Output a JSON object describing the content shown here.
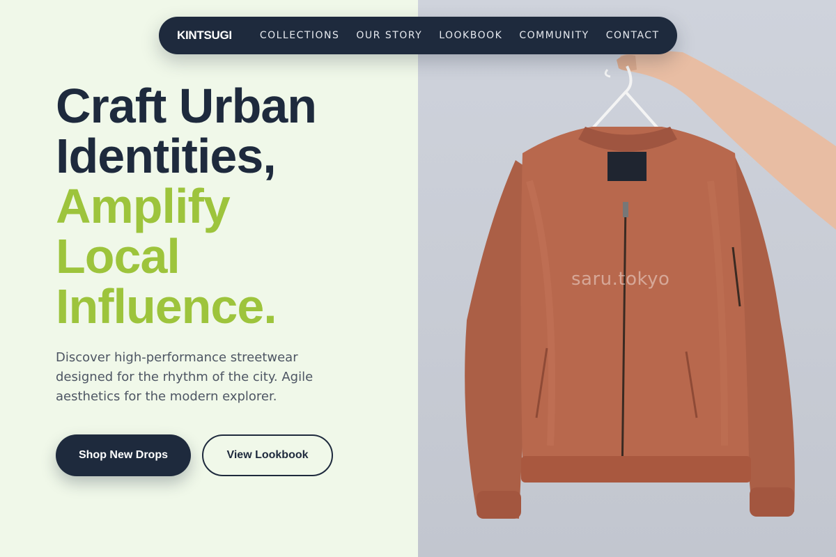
{
  "nav": {
    "brand": "KINTSUGI",
    "links": [
      "COLLECTIONS",
      "OUR STORY",
      "LOOKBOOK",
      "COMMUNITY",
      "CONTACT"
    ]
  },
  "hero": {
    "headline_dark": [
      "Craft Urban",
      "Identities,"
    ],
    "headline_accent": [
      "Amplify",
      "Local",
      "Influence."
    ],
    "description": "Discover high-performance streetwear designed for the rhythm of the city. Agile aesthetics for the modern explorer.",
    "primary_cta": "Shop New Drops",
    "secondary_cta": "View Lookbook"
  },
  "image": {
    "subject": "rust-colored bomber jacket on a hanger held by a hand",
    "watermark": "saru.tokyo"
  },
  "colors": {
    "navy": "#1e2a3d",
    "accent": "#9dc43c",
    "hero_background": "#f0f8e9",
    "photo_background": "#cfd3dc",
    "jacket": "#b8684d"
  }
}
